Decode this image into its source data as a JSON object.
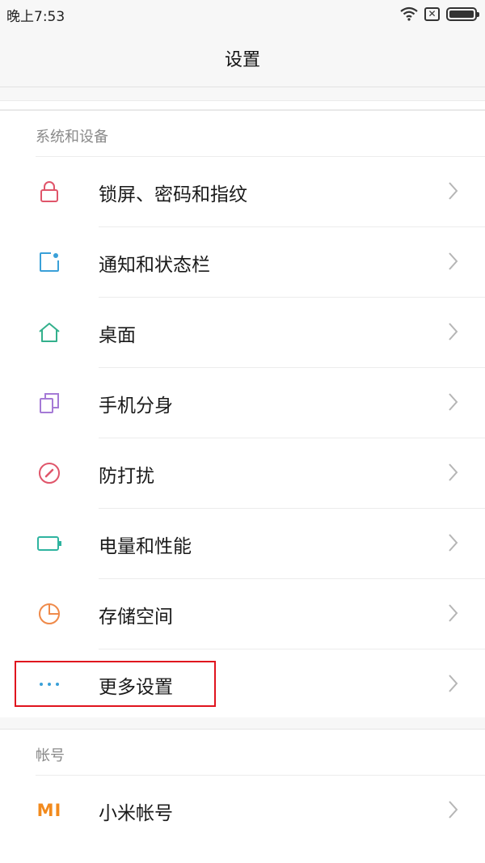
{
  "status": {
    "time": "晚上7:53",
    "sim_icon": "✕",
    "icons": [
      "wifi-icon",
      "sim-off-icon",
      "battery-icon"
    ]
  },
  "header": {
    "title": "设置"
  },
  "sections": [
    {
      "title": "系统和设备",
      "items": [
        {
          "label": "锁屏、密码和指纹",
          "icon": "lock-icon",
          "color": "#e0556a"
        },
        {
          "label": "通知和状态栏",
          "icon": "notification-icon",
          "color": "#3aa0d8"
        },
        {
          "label": "桌面",
          "icon": "home-icon",
          "color": "#33b08c"
        },
        {
          "label": "手机分身",
          "icon": "second-space-icon",
          "color": "#a57ad6"
        },
        {
          "label": "防打扰",
          "icon": "do-not-disturb-icon",
          "color": "#e0556a"
        },
        {
          "label": "电量和性能",
          "icon": "battery-performance-icon",
          "color": "#2fb4a0"
        },
        {
          "label": "存储空间",
          "icon": "storage-icon",
          "color": "#ef8a4a"
        },
        {
          "label": "更多设置",
          "icon": "more-icon",
          "color": "#3aa0d8"
        }
      ]
    },
    {
      "title": "帐号",
      "items": [
        {
          "label": "小米帐号",
          "icon": "mi-account-icon",
          "color": "#f28a1d",
          "icon_text": "MI"
        }
      ]
    }
  ],
  "highlight": {
    "target": "更多设置",
    "color": "#e0141e"
  }
}
